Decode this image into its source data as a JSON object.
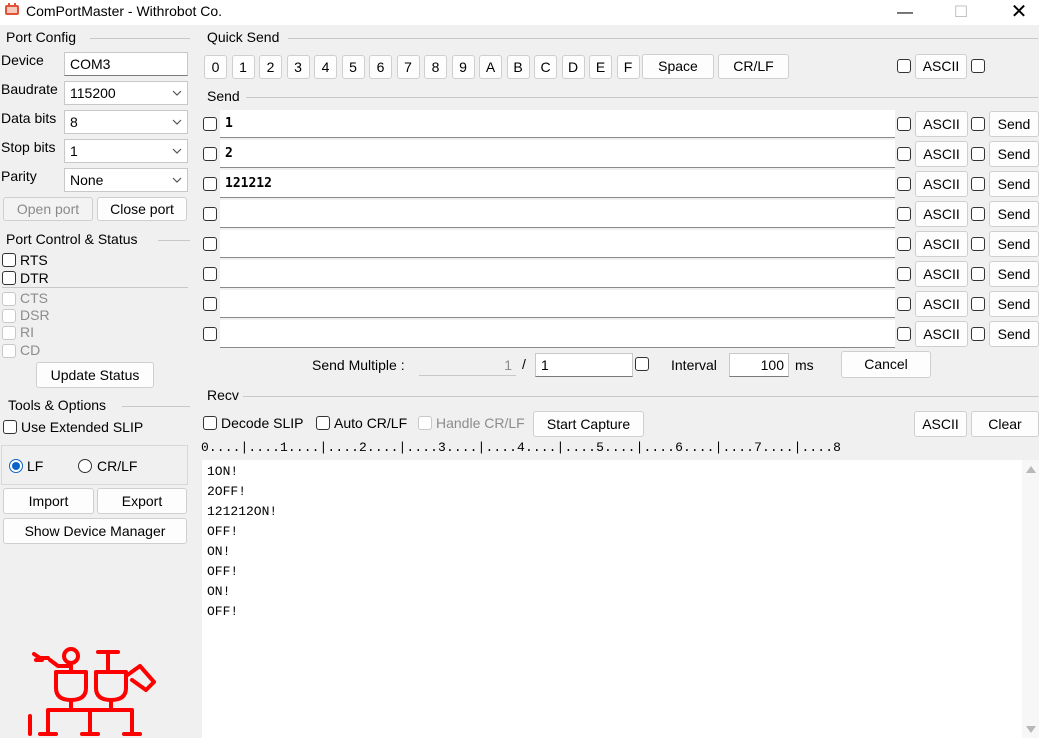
{
  "window": {
    "title": "ComPortMaster - Withrobot Co.",
    "min_glyph": "—",
    "max_glyph": "☐",
    "close_glyph": "✕"
  },
  "port_config": {
    "title": "Port Config",
    "device_label": "Device",
    "device_value": "COM3",
    "baudrate_label": "Baudrate",
    "baudrate_value": "115200",
    "databits_label": "Data bits",
    "databits_value": "8",
    "stopbits_label": "Stop bits",
    "stopbits_value": "1",
    "parity_label": "Parity",
    "parity_value": "None",
    "open_label": "Open port",
    "close_label": "Close port"
  },
  "port_control": {
    "title": "Port Control & Status",
    "rts": "RTS",
    "dtr": "DTR",
    "cts": "CTS",
    "dsr": "DSR",
    "ri": "RI",
    "cd": "CD",
    "update_label": "Update Status"
  },
  "tools": {
    "title": "Tools & Options",
    "slip_label": "Use Extended SLIP",
    "lf_label": "LF",
    "crlf_label": "CR/LF",
    "import_label": "Import",
    "export_label": "Export",
    "devmgr_label": "Show Device Manager",
    "logo_color": "#ff0000"
  },
  "quick_send": {
    "title": "Quick Send",
    "keys": [
      "0",
      "1",
      "2",
      "3",
      "4",
      "5",
      "6",
      "7",
      "8",
      "9",
      "A",
      "B",
      "C",
      "D",
      "E",
      "F"
    ],
    "space_label": "Space",
    "crlf_label": "CR/LF",
    "ascii_label": "ASCII"
  },
  "send": {
    "title": "Send",
    "rows": [
      {
        "value": "1",
        "ascii": "ASCII",
        "send": "Send"
      },
      {
        "value": "2",
        "ascii": "ASCII",
        "send": "Send"
      },
      {
        "value": "121212",
        "ascii": "ASCII",
        "send": "Send"
      },
      {
        "value": "",
        "ascii": "ASCII",
        "send": "Send"
      },
      {
        "value": "",
        "ascii": "ASCII",
        "send": "Send"
      },
      {
        "value": "",
        "ascii": "ASCII",
        "send": "Send"
      },
      {
        "value": "",
        "ascii": "ASCII",
        "send": "Send"
      },
      {
        "value": "",
        "ascii": "ASCII",
        "send": "Send"
      }
    ],
    "multiple_label": "Send Multiple :",
    "multiple_current": "1",
    "multiple_sep": "/",
    "multiple_total": "1",
    "interval_label": "Interval",
    "interval_value": "100",
    "interval_unit": "ms",
    "cancel_label": "Cancel"
  },
  "recv": {
    "title": "Recv",
    "decode_slip": "Decode SLIP",
    "auto_crlf": "Auto CR/LF",
    "handle_crlf": "Handle CR/LF",
    "capture_label": "Start Capture",
    "ascii_label": "ASCII",
    "clear_label": "Clear",
    "ruler": "0....|....1....|....2....|....3....|....4....|....5....|....6....|....7....|....8",
    "lines": [
      "1ON!",
      "2OFF!",
      "121212ON!",
      "OFF!",
      "ON!",
      "OFF!",
      "ON!",
      "OFF!"
    ]
  }
}
